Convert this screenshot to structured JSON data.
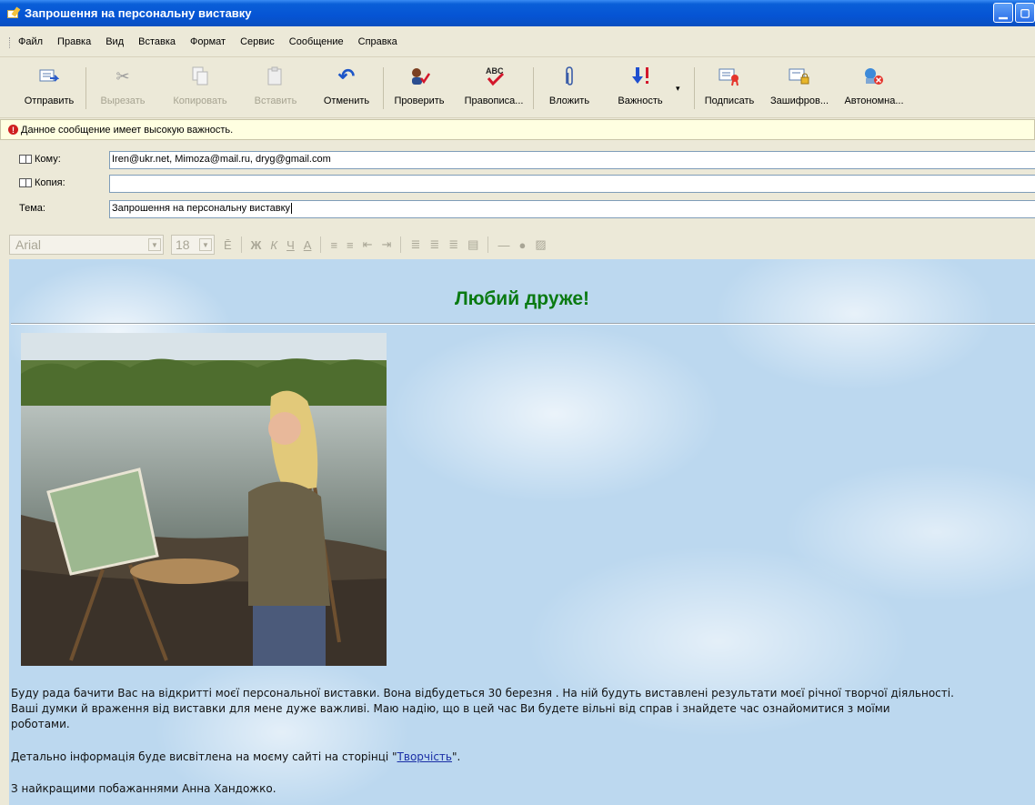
{
  "window": {
    "title": "Запрошення на персональну виставку"
  },
  "menu": [
    "Файл",
    "Правка",
    "Вид",
    "Вставка",
    "Формат",
    "Сервис",
    "Сообщение",
    "Справка"
  ],
  "toolbar": {
    "send": "Отправить",
    "cut": "Вырезать",
    "copy": "Копировать",
    "paste": "Вставить",
    "undo": "Отменить",
    "check": "Проверить",
    "spelling": "Правописа...",
    "attach": "Вложить",
    "priority": "Важность",
    "sign": "Подписать",
    "encrypt": "Зашифров...",
    "offline": "Автономна..."
  },
  "priority_notice": "Данное сообщение имеет высокую важность.",
  "fields": {
    "to_label": "Кому:",
    "to_value": "Iren@ukr.net, Mimoza@mail.ru, dryg@gmail.com",
    "cc_label": "Копия:",
    "cc_value": "",
    "subject_label": "Тема:",
    "subject_value": "Запрошення на персональну виставку"
  },
  "format": {
    "font": "Arial",
    "size": "18"
  },
  "body": {
    "greeting": "Любий друже!",
    "line1": "Буду рада бачити Вас на відкритті моєї персональної виставки. Вона відбудеться 30 березня . На ній будуть виставлені результати моєї річної творчої діяльності.",
    "line2": "Ваші думки й враження від виставки для мене дуже важливі. Маю надію, що в цей час Ви будете вільні від справ і знайдете час ознайомитися з моїми",
    "line3": "роботами.",
    "info_before": "Детально інформація буде висвітлена на моєму сайті на сторінці \"",
    "info_link": "Творчість",
    "info_after": "\".",
    "signature": "З найкращими побажаннями Анна Хандожко."
  }
}
